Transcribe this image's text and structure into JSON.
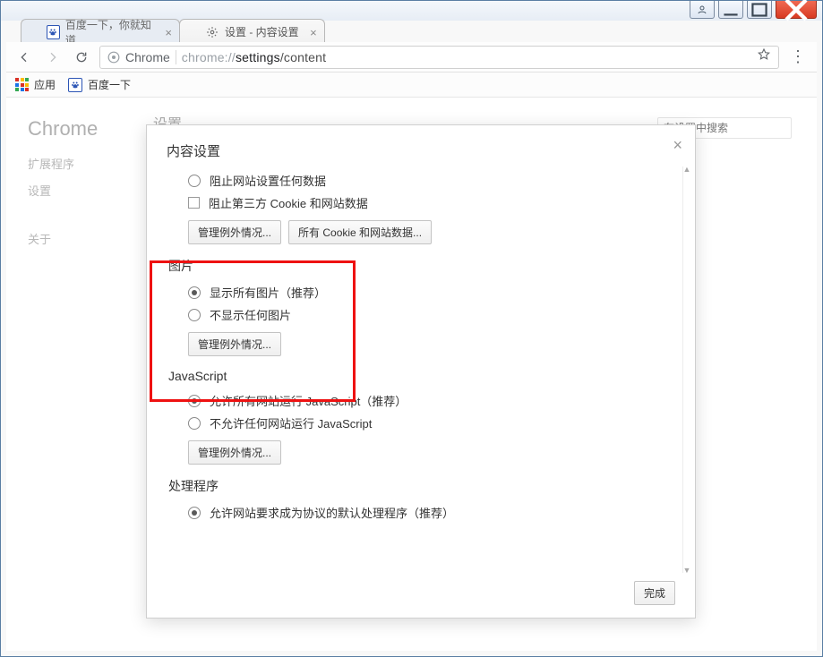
{
  "window": {
    "tabs": [
      {
        "title": "百度一下，你就知道"
      },
      {
        "title": "设置 - 内容设置"
      }
    ]
  },
  "omnibox": {
    "product": "Chrome",
    "url_prefix": "chrome://",
    "url_host": "settings",
    "url_path": "/content"
  },
  "bookmarks_bar": {
    "apps_label": "应用",
    "items": [
      {
        "label": "百度一下"
      }
    ]
  },
  "background_page": {
    "brand": "Chrome",
    "sidebar": {
      "extensions": "扩展程序",
      "settings": "设置",
      "about": "关于"
    },
    "heading": "设置",
    "search_placeholder": "在设置中搜索"
  },
  "modal": {
    "title": "内容设置",
    "close_glyph": "×",
    "cookies_block_site_set_data": "阻止网站设置任何数据",
    "cookies_block_third_party": "阻止第三方 Cookie 和网站数据",
    "btn_manage_exceptions": "管理例外情况...",
    "btn_all_cookies_data": "所有 Cookie 和网站数据...",
    "section_images": "图片",
    "images_show_all": "显示所有图片（推荐）",
    "images_show_none": "不显示任何图片",
    "section_js": "JavaScript",
    "js_allow": "允许所有网站运行 JavaScript（推荐）",
    "js_block": "不允许任何网站运行 JavaScript",
    "section_handlers": "处理程序",
    "handlers_allow": "允许网站要求成为协议的默认处理程序（推荐）",
    "btn_done": "完成"
  }
}
